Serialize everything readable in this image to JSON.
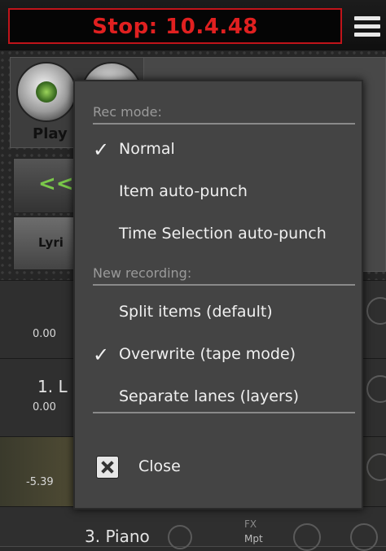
{
  "transport": {
    "status_text": "Stop: 10.4.48"
  },
  "background": {
    "play_label": "Play",
    "rewind_label": "<<",
    "lyrics_label": "Lyri",
    "tracks": [
      {
        "name": "",
        "volume": "0.00"
      },
      {
        "name": "1. L",
        "volume": "0.00"
      },
      {
        "name": "",
        "volume": "-5.39"
      },
      {
        "name": "3. Piano",
        "volume": "",
        "fx": "FX",
        "mpt": "Mpt"
      }
    ]
  },
  "popup": {
    "rec_mode_header": "Rec mode:",
    "rec_mode_items": [
      {
        "label": "Normal",
        "checked": true,
        "check_glyph": "✓"
      },
      {
        "label": "Item auto-punch",
        "checked": false,
        "check_glyph": ""
      },
      {
        "label": "Time Selection auto-punch",
        "checked": false,
        "check_glyph": ""
      }
    ],
    "new_recording_header": "New recording:",
    "new_recording_items": [
      {
        "label": "Split items (default)",
        "checked": false,
        "check_glyph": ""
      },
      {
        "label": "Overwrite (tape mode)",
        "checked": true,
        "check_glyph": "✓"
      },
      {
        "label": "Separate lanes (layers)",
        "checked": false,
        "check_glyph": ""
      }
    ],
    "close_label": "Close"
  },
  "colors": {
    "accent": "#e02020",
    "popup_bg": "#444444"
  }
}
